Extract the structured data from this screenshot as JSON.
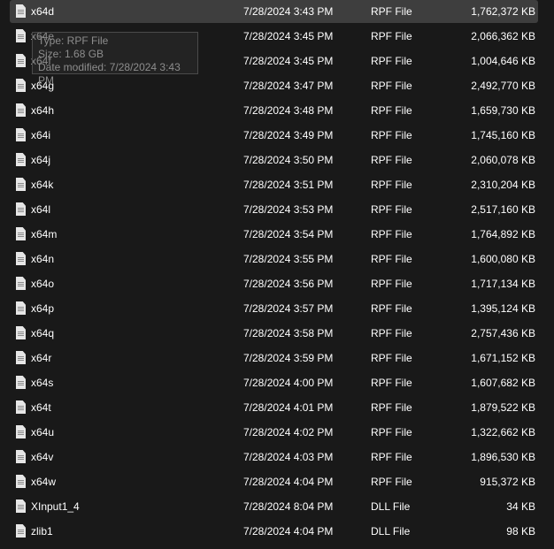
{
  "files": [
    {
      "name": "x64d",
      "date": "7/28/2024 3:43 PM",
      "type": "RPF File",
      "size": "1,762,372 KB",
      "selected": true
    },
    {
      "name": "x64e",
      "date": "7/28/2024 3:45 PM",
      "type": "RPF File",
      "size": "2,066,362 KB"
    },
    {
      "name": "x64f",
      "date": "7/28/2024 3:45 PM",
      "type": "RPF File",
      "size": "1,004,646 KB"
    },
    {
      "name": "x64g",
      "date": "7/28/2024 3:47 PM",
      "type": "RPF File",
      "size": "2,492,770 KB"
    },
    {
      "name": "x64h",
      "date": "7/28/2024 3:48 PM",
      "type": "RPF File",
      "size": "1,659,730 KB"
    },
    {
      "name": "x64i",
      "date": "7/28/2024 3:49 PM",
      "type": "RPF File",
      "size": "1,745,160 KB"
    },
    {
      "name": "x64j",
      "date": "7/28/2024 3:50 PM",
      "type": "RPF File",
      "size": "2,060,078 KB"
    },
    {
      "name": "x64k",
      "date": "7/28/2024 3:51 PM",
      "type": "RPF File",
      "size": "2,310,204 KB"
    },
    {
      "name": "x64l",
      "date": "7/28/2024 3:53 PM",
      "type": "RPF File",
      "size": "2,517,160 KB"
    },
    {
      "name": "x64m",
      "date": "7/28/2024 3:54 PM",
      "type": "RPF File",
      "size": "1,764,892 KB"
    },
    {
      "name": "x64n",
      "date": "7/28/2024 3:55 PM",
      "type": "RPF File",
      "size": "1,600,080 KB"
    },
    {
      "name": "x64o",
      "date": "7/28/2024 3:56 PM",
      "type": "RPF File",
      "size": "1,717,134 KB"
    },
    {
      "name": "x64p",
      "date": "7/28/2024 3:57 PM",
      "type": "RPF File",
      "size": "1,395,124 KB"
    },
    {
      "name": "x64q",
      "date": "7/28/2024 3:58 PM",
      "type": "RPF File",
      "size": "2,757,436 KB"
    },
    {
      "name": "x64r",
      "date": "7/28/2024 3:59 PM",
      "type": "RPF File",
      "size": "1,671,152 KB"
    },
    {
      "name": "x64s",
      "date": "7/28/2024 4:00 PM",
      "type": "RPF File",
      "size": "1,607,682 KB"
    },
    {
      "name": "x64t",
      "date": "7/28/2024 4:01 PM",
      "type": "RPF File",
      "size": "1,879,522 KB"
    },
    {
      "name": "x64u",
      "date": "7/28/2024 4:02 PM",
      "type": "RPF File",
      "size": "1,322,662 KB"
    },
    {
      "name": "x64v",
      "date": "7/28/2024 4:03 PM",
      "type": "RPF File",
      "size": "1,896,530 KB"
    },
    {
      "name": "x64w",
      "date": "7/28/2024 4:04 PM",
      "type": "RPF File",
      "size": "915,372 KB"
    },
    {
      "name": "XInput1_4",
      "date": "7/28/2024 8:04 PM",
      "type": "DLL File",
      "size": "34 KB"
    },
    {
      "name": "zlib1",
      "date": "7/28/2024 4:04 PM",
      "type": "DLL File",
      "size": "98 KB"
    }
  ],
  "tooltip": {
    "type": "Type: RPF File",
    "size": "Size: 1.68 GB",
    "modified": "Date modified: 7/28/2024 3:43 PM"
  }
}
